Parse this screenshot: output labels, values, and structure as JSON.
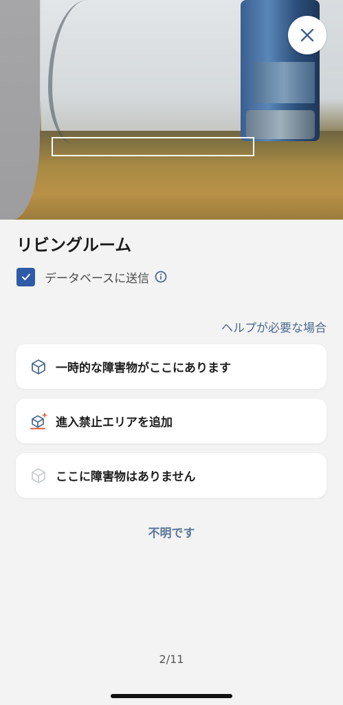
{
  "photo": {
    "icon": "camera-view"
  },
  "close": {
    "icon": "close-icon"
  },
  "room": {
    "title": "リビングルーム"
  },
  "send_to_db": {
    "label": "データベースに送信",
    "checked": true,
    "accent": "#2f5aa6"
  },
  "help": {
    "label": "ヘルプが必要な場合"
  },
  "options": [
    {
      "label": "一時的な障害物がここにあります",
      "icon": "box-icon"
    },
    {
      "label": "進入禁止エリアを追加",
      "icon": "box-add-zone-icon"
    },
    {
      "label": "ここに障害物はありません",
      "icon": "box-outline-icon"
    }
  ],
  "unknown": {
    "label": "不明です"
  },
  "pager": {
    "text": "2/11"
  }
}
